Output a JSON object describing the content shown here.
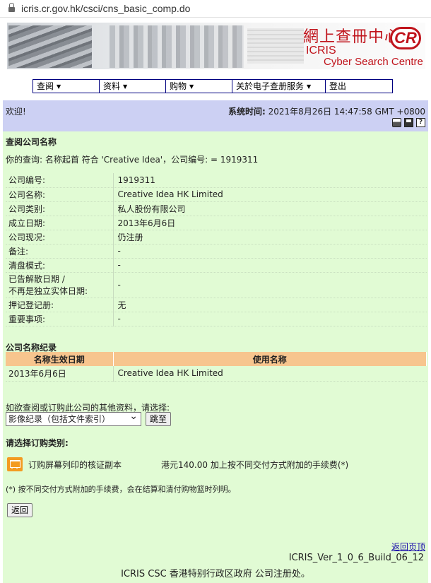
{
  "browser": {
    "url": "icris.cr.gov.hk/csci/cns_basic_comp.do"
  },
  "banner": {
    "title_cn": "網上查冊中心",
    "brand": "ICRIS",
    "subtitle": "Cyber Search Centre",
    "logo_text": "CR"
  },
  "menu": [
    {
      "label": "查阅",
      "dropdown": true
    },
    {
      "label": "资料",
      "dropdown": true
    },
    {
      "label": "购物",
      "dropdown": true
    },
    {
      "label": "关於电子查册服务",
      "dropdown": true
    },
    {
      "label": "登出",
      "dropdown": false
    }
  ],
  "header": {
    "welcome": "欢迎!",
    "systime_label": "系统时间:",
    "systime_value": "2021年8月26日 14:47:58 GMT +0800",
    "icons": [
      "printer-icon",
      "save-icon",
      "help-icon"
    ]
  },
  "search": {
    "title": "查阅公司名称",
    "query_text": "你的查询:  名称起首 符合 'Creative Idea'，公司编号:  = 1919311"
  },
  "company": [
    {
      "label": "公司编号:",
      "value": "1919311"
    },
    {
      "label": "公司名称:",
      "value": "Creative Idea HK Limited"
    },
    {
      "label": "公司类别:",
      "value": "私人股份有限公司"
    },
    {
      "label": "成立日期:",
      "value": "2013年6月6日"
    },
    {
      "label": "公司现况:",
      "value": "仍注册"
    },
    {
      "label": "备注:",
      "value": "-"
    },
    {
      "label": "清盘模式:",
      "value": "-"
    },
    {
      "label": "已告解散日期 /",
      "label2": "不再是独立实体日期:",
      "value": "-"
    },
    {
      "label": "押记登记册:",
      "value": "无"
    },
    {
      "label": "重要事项:",
      "value": "-"
    }
  ],
  "history": {
    "title": "公司名称纪录",
    "columns": [
      "名称生效日期",
      "使用名称"
    ],
    "rows": [
      {
        "date": "2013年6月6日",
        "name": "Creative Idea HK Limited"
      }
    ]
  },
  "more": {
    "prompt": "如欲查阅或订购此公司的其他资料，请选择:",
    "select_value": "影像纪录（包括文件索引）",
    "go_label": "跳至"
  },
  "order": {
    "title": "请选择订购类别:",
    "item_label": "订购屏幕列印的核证副本",
    "item_price": "港元140.00 加上按不同交付方式附加的手续费(*)",
    "note": "(*) 按不同交付方式附加的手续费，会在结算和清付购物篮时列明。",
    "back_label": "返回"
  },
  "footer": {
    "home_link": "返回页顶",
    "build": "ICRIS_Ver_1_0_6_Build_06_12",
    "org": "ICRIS CSC 香港特别行政区政府 公司注册处。"
  }
}
